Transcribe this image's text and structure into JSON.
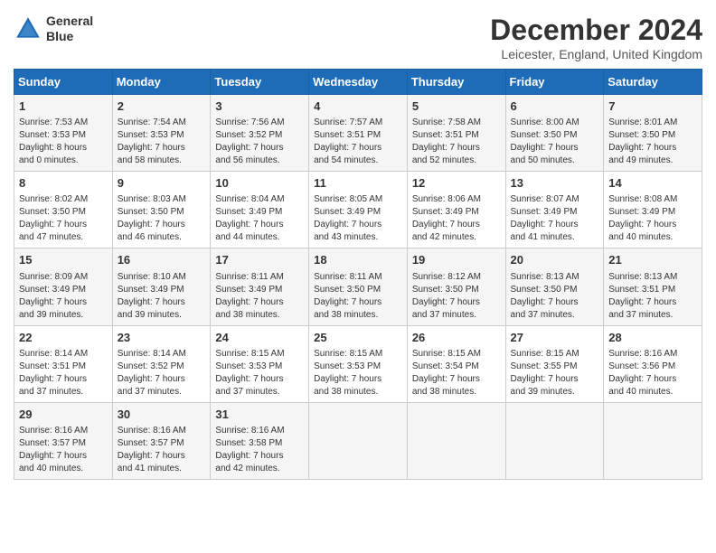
{
  "logo": {
    "line1": "General",
    "line2": "Blue"
  },
  "title": "December 2024",
  "location": "Leicester, England, United Kingdom",
  "days_header": [
    "Sunday",
    "Monday",
    "Tuesday",
    "Wednesday",
    "Thursday",
    "Friday",
    "Saturday"
  ],
  "weeks": [
    [
      {
        "day": "1",
        "info": "Sunrise: 7:53 AM\nSunset: 3:53 PM\nDaylight: 8 hours\nand 0 minutes."
      },
      {
        "day": "2",
        "info": "Sunrise: 7:54 AM\nSunset: 3:53 PM\nDaylight: 7 hours\nand 58 minutes."
      },
      {
        "day": "3",
        "info": "Sunrise: 7:56 AM\nSunset: 3:52 PM\nDaylight: 7 hours\nand 56 minutes."
      },
      {
        "day": "4",
        "info": "Sunrise: 7:57 AM\nSunset: 3:51 PM\nDaylight: 7 hours\nand 54 minutes."
      },
      {
        "day": "5",
        "info": "Sunrise: 7:58 AM\nSunset: 3:51 PM\nDaylight: 7 hours\nand 52 minutes."
      },
      {
        "day": "6",
        "info": "Sunrise: 8:00 AM\nSunset: 3:50 PM\nDaylight: 7 hours\nand 50 minutes."
      },
      {
        "day": "7",
        "info": "Sunrise: 8:01 AM\nSunset: 3:50 PM\nDaylight: 7 hours\nand 49 minutes."
      }
    ],
    [
      {
        "day": "8",
        "info": "Sunrise: 8:02 AM\nSunset: 3:50 PM\nDaylight: 7 hours\nand 47 minutes."
      },
      {
        "day": "9",
        "info": "Sunrise: 8:03 AM\nSunset: 3:50 PM\nDaylight: 7 hours\nand 46 minutes."
      },
      {
        "day": "10",
        "info": "Sunrise: 8:04 AM\nSunset: 3:49 PM\nDaylight: 7 hours\nand 44 minutes."
      },
      {
        "day": "11",
        "info": "Sunrise: 8:05 AM\nSunset: 3:49 PM\nDaylight: 7 hours\nand 43 minutes."
      },
      {
        "day": "12",
        "info": "Sunrise: 8:06 AM\nSunset: 3:49 PM\nDaylight: 7 hours\nand 42 minutes."
      },
      {
        "day": "13",
        "info": "Sunrise: 8:07 AM\nSunset: 3:49 PM\nDaylight: 7 hours\nand 41 minutes."
      },
      {
        "day": "14",
        "info": "Sunrise: 8:08 AM\nSunset: 3:49 PM\nDaylight: 7 hours\nand 40 minutes."
      }
    ],
    [
      {
        "day": "15",
        "info": "Sunrise: 8:09 AM\nSunset: 3:49 PM\nDaylight: 7 hours\nand 39 minutes."
      },
      {
        "day": "16",
        "info": "Sunrise: 8:10 AM\nSunset: 3:49 PM\nDaylight: 7 hours\nand 39 minutes."
      },
      {
        "day": "17",
        "info": "Sunrise: 8:11 AM\nSunset: 3:49 PM\nDaylight: 7 hours\nand 38 minutes."
      },
      {
        "day": "18",
        "info": "Sunrise: 8:11 AM\nSunset: 3:50 PM\nDaylight: 7 hours\nand 38 minutes."
      },
      {
        "day": "19",
        "info": "Sunrise: 8:12 AM\nSunset: 3:50 PM\nDaylight: 7 hours\nand 37 minutes."
      },
      {
        "day": "20",
        "info": "Sunrise: 8:13 AM\nSunset: 3:50 PM\nDaylight: 7 hours\nand 37 minutes."
      },
      {
        "day": "21",
        "info": "Sunrise: 8:13 AM\nSunset: 3:51 PM\nDaylight: 7 hours\nand 37 minutes."
      }
    ],
    [
      {
        "day": "22",
        "info": "Sunrise: 8:14 AM\nSunset: 3:51 PM\nDaylight: 7 hours\nand 37 minutes."
      },
      {
        "day": "23",
        "info": "Sunrise: 8:14 AM\nSunset: 3:52 PM\nDaylight: 7 hours\nand 37 minutes."
      },
      {
        "day": "24",
        "info": "Sunrise: 8:15 AM\nSunset: 3:53 PM\nDaylight: 7 hours\nand 37 minutes."
      },
      {
        "day": "25",
        "info": "Sunrise: 8:15 AM\nSunset: 3:53 PM\nDaylight: 7 hours\nand 38 minutes."
      },
      {
        "day": "26",
        "info": "Sunrise: 8:15 AM\nSunset: 3:54 PM\nDaylight: 7 hours\nand 38 minutes."
      },
      {
        "day": "27",
        "info": "Sunrise: 8:15 AM\nSunset: 3:55 PM\nDaylight: 7 hours\nand 39 minutes."
      },
      {
        "day": "28",
        "info": "Sunrise: 8:16 AM\nSunset: 3:56 PM\nDaylight: 7 hours\nand 40 minutes."
      }
    ],
    [
      {
        "day": "29",
        "info": "Sunrise: 8:16 AM\nSunset: 3:57 PM\nDaylight: 7 hours\nand 40 minutes."
      },
      {
        "day": "30",
        "info": "Sunrise: 8:16 AM\nSunset: 3:57 PM\nDaylight: 7 hours\nand 41 minutes."
      },
      {
        "day": "31",
        "info": "Sunrise: 8:16 AM\nSunset: 3:58 PM\nDaylight: 7 hours\nand 42 minutes."
      },
      null,
      null,
      null,
      null
    ]
  ]
}
